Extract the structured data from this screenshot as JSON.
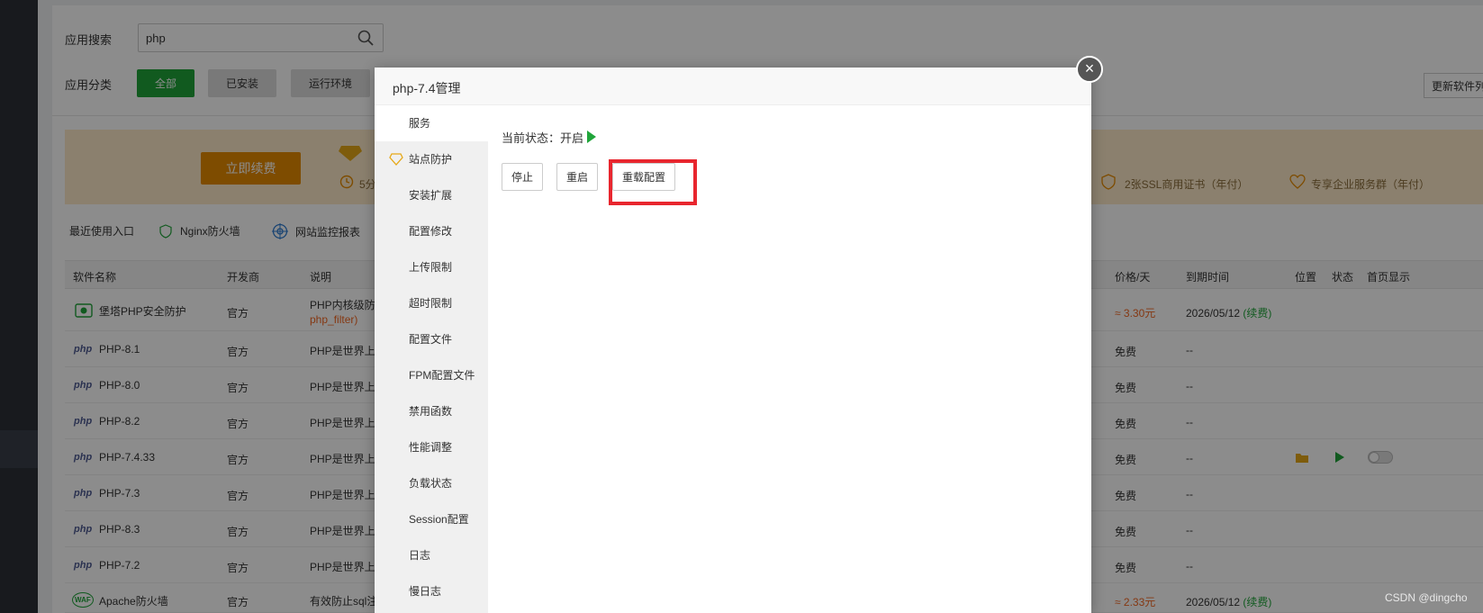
{
  "search": {
    "label": "应用搜索",
    "value": "php",
    "placeholder": ""
  },
  "category": {
    "label": "应用分类",
    "buttons": [
      "全部",
      "已安装",
      "运行环境"
    ],
    "update_button": "更新软件列表"
  },
  "banner": {
    "renew_button": "立即续费",
    "text_partial": "5分",
    "ssl": "2张SSL商用证书（年付）",
    "service": "专享企业服务群（年付）"
  },
  "quick": {
    "label": "最近使用入口",
    "items": [
      "Nginx防火墙",
      "网站监控报表"
    ]
  },
  "table": {
    "headers": {
      "name": "软件名称",
      "developer": "开发商",
      "desc": "说明",
      "price": "价格/天",
      "expire": "到期时间",
      "location": "位置",
      "status": "状态",
      "home": "首页显示"
    },
    "rows": [
      {
        "name": "堡塔PHP安全防护",
        "dev": "官方",
        "desc": "PHP内核级防",
        "desc2": "php_filter)",
        "price": "≈ 3.30元",
        "expire": "2026/05/12",
        "renew": "(续费)"
      },
      {
        "name": "PHP-8.1",
        "dev": "官方",
        "desc": "PHP是世界上",
        "price": "免费",
        "expire": "--"
      },
      {
        "name": "PHP-8.0",
        "dev": "官方",
        "desc": "PHP是世界上",
        "price": "免费",
        "expire": "--"
      },
      {
        "name": "PHP-8.2",
        "dev": "官方",
        "desc": "PHP是世界上",
        "price": "免费",
        "expire": "--"
      },
      {
        "name": "PHP-7.4.33",
        "dev": "官方",
        "desc": "PHP是世界上",
        "price": "免费",
        "expire": "--"
      },
      {
        "name": "PHP-7.3",
        "dev": "官方",
        "desc": "PHP是世界上",
        "price": "免费",
        "expire": "--"
      },
      {
        "name": "PHP-8.3",
        "dev": "官方",
        "desc": "PHP是世界上",
        "price": "免费",
        "expire": "--"
      },
      {
        "name": "PHP-7.2",
        "dev": "官方",
        "desc": "PHP是世界上",
        "price": "免费",
        "expire": "--"
      },
      {
        "name": "Apache防火墙",
        "dev": "官方",
        "desc": "有效防止sql注",
        "price": "≈ 2.33元",
        "expire": "2026/05/12",
        "renew": "(续费)"
      }
    ],
    "php_logo": "php",
    "waf_logo": "WAF"
  },
  "modal": {
    "title": "php-7.4管理",
    "close": "×",
    "menu": [
      "服务",
      "站点防护",
      "安装扩展",
      "配置修改",
      "上传限制",
      "超时限制",
      "配置文件",
      "FPM配置文件",
      "禁用函数",
      "性能调整",
      "负载状态",
      "Session配置",
      "日志",
      "慢日志"
    ],
    "status_label": "当前状态：",
    "status_value": "开启",
    "buttons": {
      "stop": "停止",
      "restart": "重启",
      "reload": "重载配置"
    }
  },
  "watermark": "CSDN @dingcho",
  "colors": {
    "accent": "#20a53a",
    "highlight": "#e8262e",
    "orange": "#f26722"
  }
}
